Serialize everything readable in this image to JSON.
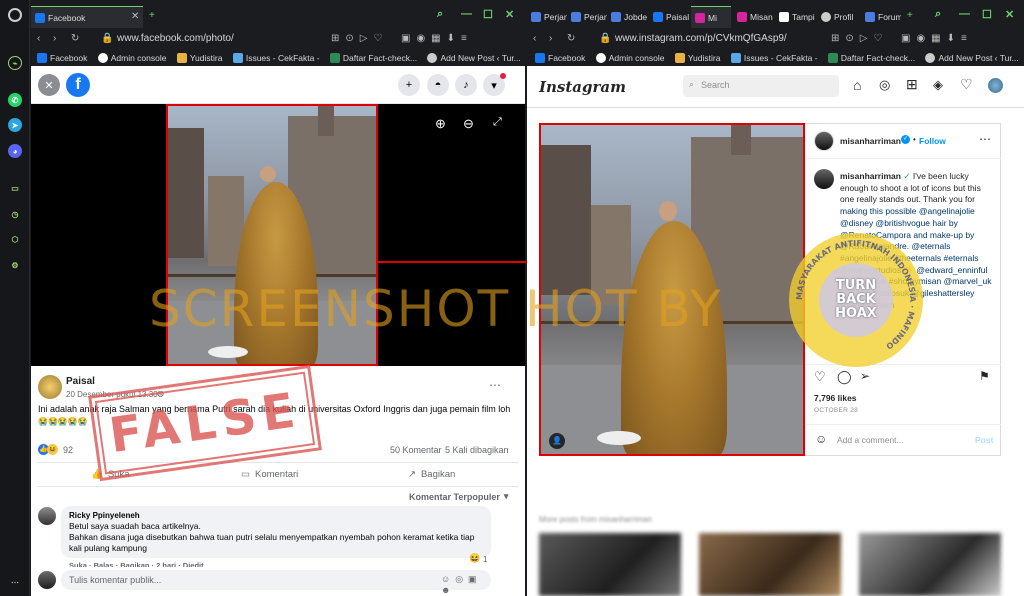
{
  "left_window": {
    "tab_title": "Facebook",
    "url": "www.facebook.com/photo/",
    "bookmarks": [
      "Facebook",
      "Admin console",
      "Yudistira",
      "Issues - CekFakta -",
      "Daftar Fact-check...",
      "Add New Post ‹ Tur..."
    ],
    "post": {
      "author": "Paisal",
      "date": "20 Desember pukul 13.30 ·",
      "caption": "Ini adalah anak raja Salman yang bernama Putri sarah dia kuliah di universitas Oxford Inggris dan juga pemain film loh",
      "emoji_line": "😭😭😭😭😭",
      "reaction_count": "92",
      "comment_count": "50 Komentar",
      "share_count": "5 Kali dibagikan",
      "like_label": "Suka",
      "comment_label": "Komentari",
      "share_label": "Bagikan",
      "sort_label": "Komentar Terpopuler"
    },
    "comment": {
      "author": "Ricky Ppinyeleneh",
      "line1": "Betul saya suadah baca artikelnya.",
      "line2": "Bahkan disana juga disebutkan bahwa tuan putri selalu menyempatkan nyembah pohon keramat ketika tiap kali pulang kampung",
      "reaction_count": "1",
      "meta": "Suka · Balas · Bagikan · 2 hari · Diedit"
    },
    "comment_input_placeholder": "Tulis komentar publik..."
  },
  "right_window": {
    "tabs": [
      "Perjan",
      "Perjan",
      "Jobde",
      "Paisal",
      "Mi",
      "Misan",
      "Tampi",
      "Profil",
      "Forum"
    ],
    "url": "www.instagram.com/p/CVkmQfGAsp9/",
    "bookmarks": [
      "Facebook",
      "Admin console",
      "Yudistira",
      "Issues - CekFakta -",
      "Daftar Fact-check...",
      "Add New Post ‹ Tur..."
    ],
    "logo": "Instagram",
    "search_placeholder": "Search",
    "username": "misanharriman",
    "follow_label": "Follow",
    "caption_lines": [
      "I've been lucky",
      "enough to shoot a lot of icons but this",
      "one really stands out. Thank you for",
      "making this possible @angelinajolie",
      "@disney @britishvogue hair by",
      "@RenatoCampora and make-up by",
      "@RaoulAlejandre. @eternals",
      "#angelinajolie #theeternals #eternals",
      "@marvelstudios ✨ @edward_enninful",
      "@ppgerdhai #shotbymisan @marvel_uk",
      "@disneystudiosuk @gileshattersley",
      "@jasonbolden"
    ],
    "likes": "7,796 likes",
    "post_date": "OCTOBER 28",
    "comment_placeholder": "Add a comment...",
    "post_label": "Post",
    "more_posts": "More posts from misanharriman"
  },
  "overlays": {
    "watermark": "SCREENSHOT BY",
    "false_stamp": "FALSE",
    "seal_center": [
      "TURN",
      "BACK",
      "HOAX"
    ],
    "seal_ring": "MASYARAKAT ANTIFITNAH INDONESIA · MAFINDO"
  },
  "colors": {
    "fb_blue": "#1877f2",
    "stamp_red": "#d9534f",
    "ig_blue": "#0095f6",
    "window_bg": "#1b1c20",
    "highlight_red": "#e00000"
  }
}
